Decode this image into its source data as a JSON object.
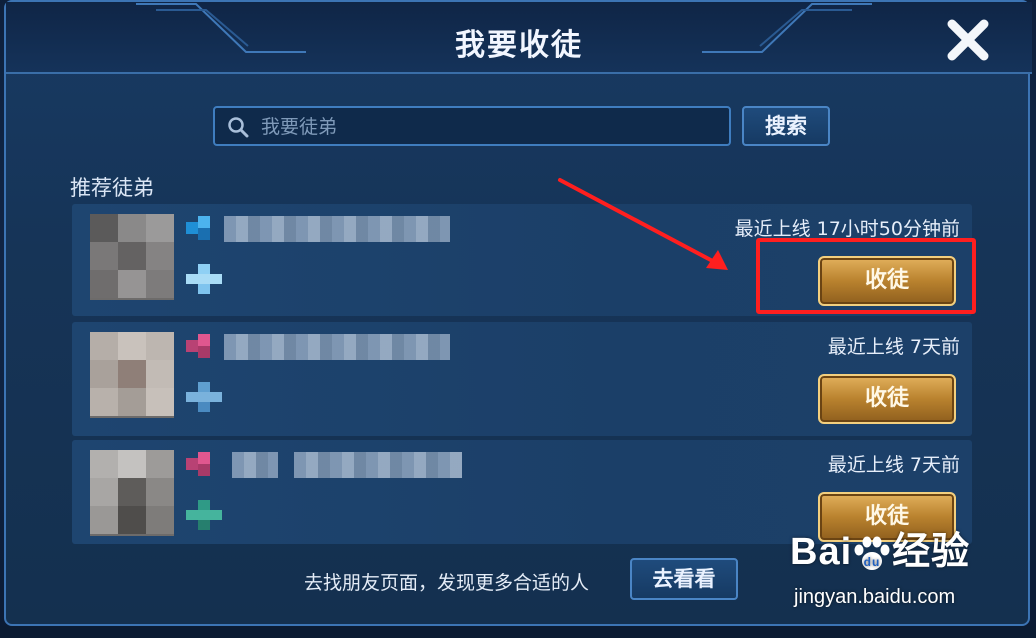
{
  "dialog": {
    "title": "我要收徒",
    "close_icon": "close-icon"
  },
  "search": {
    "placeholder": "我要徒弟",
    "button_label": "搜索",
    "icon": "search-icon"
  },
  "section": {
    "label": "推荐徒弟"
  },
  "candidates": [
    {
      "last_online": "最近上线  17小时50分钟前",
      "button_label": "收徒",
      "rank_color": "#1f8fd6",
      "sub_color": "#7fc4ee"
    },
    {
      "last_online": "最近上线  7天前",
      "button_label": "收徒",
      "rank_color": "#e0578f",
      "sub_color": "#5f9fd0"
    },
    {
      "last_online": "最近上线  7天前",
      "button_label": "收徒",
      "rank_color": "#e0578f",
      "sub_color": "#2f9a86"
    }
  ],
  "footer": {
    "text": "去找朋友页面，发现更多合适的人",
    "button_label": "去看看"
  },
  "watermark": {
    "brand": "Bai",
    "brand_suffix": "经验",
    "url": "jingyan.baidu.com"
  },
  "colors": {
    "accent_gold": "#c9913a",
    "annotation_red": "#ff1f1f",
    "frame_blue": "#3c74b4"
  }
}
